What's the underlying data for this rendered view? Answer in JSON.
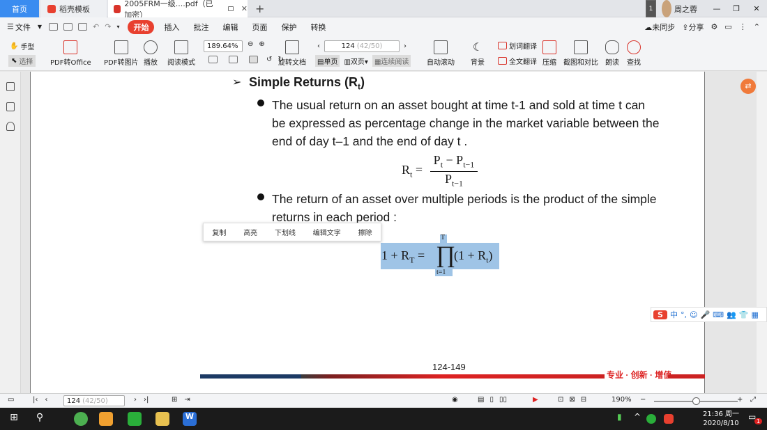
{
  "tabs": {
    "home": "首页",
    "daoke": "稻壳模板",
    "pdf": "2005FRM一级....pdf（已加密）"
  },
  "window": {
    "badge": "1",
    "user": "周之蓉"
  },
  "menu": {
    "file": "文件",
    "items": [
      "开始",
      "插入",
      "批注",
      "编辑",
      "页面",
      "保护",
      "转换"
    ],
    "unsync": "未同步",
    "share": "分享"
  },
  "toolbar": {
    "hand": "手型",
    "select": "选择",
    "pdf_office": "PDF转Office",
    "pdf_image": "PDF转图片",
    "play": "播放",
    "read_mode": "阅读模式",
    "zoom": "189.64%",
    "rotate": "旋转文档",
    "page_input": "124",
    "page_total": "(42/50)",
    "single": "单页",
    "double": "双页",
    "continuous": "连续阅读",
    "auto_scroll": "自动滚动",
    "background": "背景",
    "word_translate": "划词翻译",
    "full_translate": "全文翻译",
    "compress": "压缩",
    "screenshot": "截图和对比",
    "read_aloud": "朗读",
    "search": "查找"
  },
  "doc": {
    "heading": "Simple Returns (R",
    "heading_sub": "t",
    "heading_tail": ")",
    "p1": [
      "The usual return on an asset bought at time t-1 and sold at time t can",
      "be expressed as percentage change in the market variable between the",
      "end of day t–1 and the end of day t ."
    ],
    "p2": [
      "The return of an asset over multiple periods is the product of the simple",
      "returns in each period :"
    ],
    "page_label": "124-149",
    "footer_slogan": "专业 · 创新 · 增值"
  },
  "context_menu": [
    "复制",
    "高亮",
    "下划线",
    "编辑文字",
    "擦除"
  ],
  "statusbar": {
    "page": "124",
    "page_total": "(42/50)",
    "zoom": "190%"
  },
  "ime": {
    "mode": "中"
  },
  "taskbar": {
    "time": "21:36 周一",
    "date": "2020/8/10",
    "notif": "1"
  }
}
